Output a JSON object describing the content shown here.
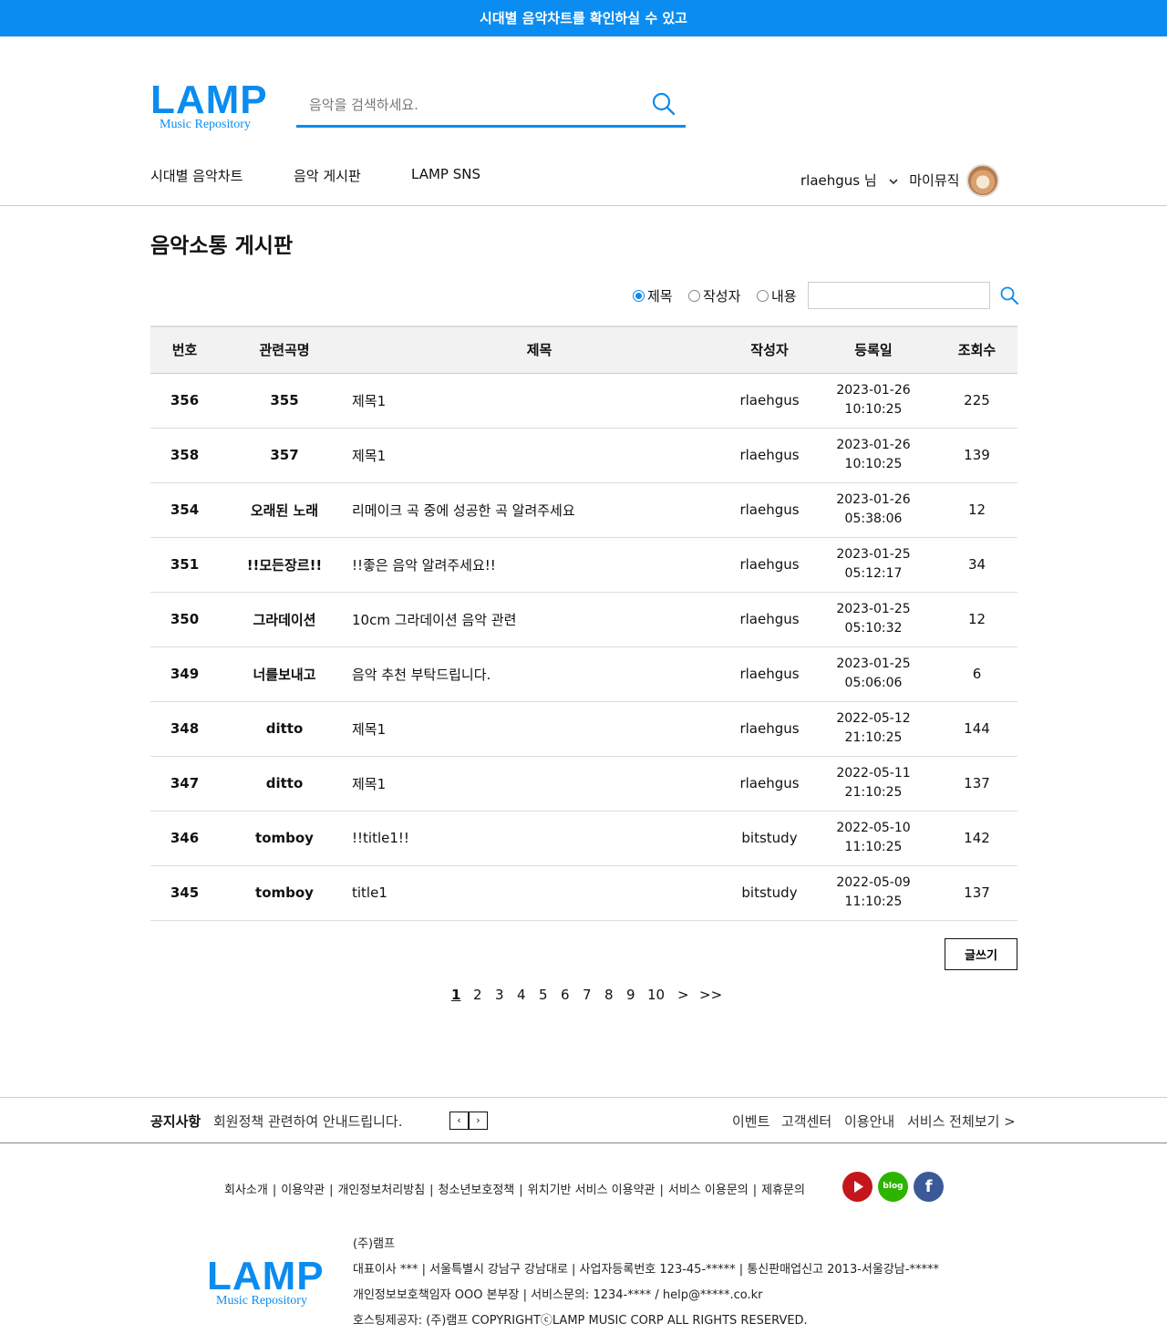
{
  "topbar": {
    "message": "시대별 음악차트를 확인하실 수 있고"
  },
  "header": {
    "logo_text": "LAMP",
    "logo_sub": "Music Repository",
    "search_placeholder": "음악을 검색하세요.",
    "search_icon": "search-icon"
  },
  "nav": {
    "items": [
      "시대별 음악차트",
      "음악 게시판",
      "LAMP SNS"
    ],
    "user_label": "rlaehgus 님",
    "user_menu_icon": "chevron-down-icon",
    "mymusic_label": "마이뮤직"
  },
  "board": {
    "title": "음악소통 게시판",
    "filter": {
      "options": [
        "제목",
        "작성자",
        "내용"
      ],
      "selected": "제목",
      "input_value": ""
    },
    "columns": [
      "번호",
      "관련곡명",
      "제목",
      "작성자",
      "등록일",
      "조회수"
    ],
    "rows": [
      {
        "num": "356",
        "song": "355",
        "title": "제목1",
        "writer": "rlaehgus",
        "date": "2023-01-26",
        "time": "10:10:25",
        "views": "225"
      },
      {
        "num": "358",
        "song": "357",
        "title": "제목1",
        "writer": "rlaehgus",
        "date": "2023-01-26",
        "time": "10:10:25",
        "views": "139"
      },
      {
        "num": "354",
        "song": "오래된 노래",
        "title": "리메이크 곡 중에 성공한 곡 알려주세요",
        "writer": "rlaehgus",
        "date": "2023-01-26",
        "time": "05:38:06",
        "views": "12"
      },
      {
        "num": "351",
        "song": "!!모든장르!!",
        "title": "!!좋은 음악 알려주세요!!",
        "writer": "rlaehgus",
        "date": "2023-01-25",
        "time": "05:12:17",
        "views": "34"
      },
      {
        "num": "350",
        "song": "그라데이션",
        "title": "10cm 그라데이션 음악 관련",
        "writer": "rlaehgus",
        "date": "2023-01-25",
        "time": "05:10:32",
        "views": "12"
      },
      {
        "num": "349",
        "song": "너를보내고",
        "title": "음악 추천 부탁드립니다.",
        "writer": "rlaehgus",
        "date": "2023-01-25",
        "time": "05:06:06",
        "views": "6"
      },
      {
        "num": "348",
        "song": "ditto",
        "title": "제목1",
        "writer": "rlaehgus",
        "date": "2022-05-12",
        "time": "21:10:25",
        "views": "144"
      },
      {
        "num": "347",
        "song": "ditto",
        "title": "제목1",
        "writer": "rlaehgus",
        "date": "2022-05-11",
        "time": "21:10:25",
        "views": "137"
      },
      {
        "num": "346",
        "song": "tomboy",
        "title": "!!title1!!",
        "writer": "bitstudy",
        "date": "2022-05-10",
        "time": "11:10:25",
        "views": "142"
      },
      {
        "num": "345",
        "song": "tomboy",
        "title": "title1",
        "writer": "bitstudy",
        "date": "2022-05-09",
        "time": "11:10:25",
        "views": "137"
      }
    ],
    "write_button": "글쓰기"
  },
  "pagination": {
    "pages": [
      "1",
      "2",
      "3",
      "4",
      "5",
      "6",
      "7",
      "8",
      "9",
      "10"
    ],
    "current": "1",
    "next": ">",
    "last": ">>"
  },
  "notice": {
    "label": "공지사항",
    "text": "회원정책 관련하여 안내드립니다.",
    "prev": "‹",
    "next": "›",
    "links": [
      "이벤트",
      "고객센터",
      "이용안내",
      "서비스 전체보기 >"
    ]
  },
  "footer": {
    "links": [
      "회사소개",
      "이용약관",
      "개인정보처리방침",
      "청소년보호정책",
      "위치기반 서비스 이용약관",
      "서비스 이용문의",
      "제휴문의"
    ],
    "sns": [
      {
        "name": "youtube-icon",
        "color": "#c4161c"
      },
      {
        "name": "blog-icon",
        "color": "#2db400",
        "text": "blog"
      },
      {
        "name": "facebook-icon",
        "color": "#3b5998",
        "text": "f"
      }
    ],
    "logo_text": "LAMP",
    "logo_sub": "Music Repository",
    "company_lines": [
      "(주)램프",
      "대표이사 *** | 서울특별시 강남구 강남대로 | 사업자등록번호 123-45-***** | 통신판매업신고 2013-서울강남-*****",
      "개인정보보호책임자 OOO 본부장 | 서비스문의: 1234-**** / help@*****.co.kr",
      "호스팅제공자: (주)램프 COPYRIGHTⓒLAMP MUSIC CORP ALL RIGHTS RESERVED."
    ]
  },
  "colors": {
    "accent": "#0a8cf0"
  }
}
